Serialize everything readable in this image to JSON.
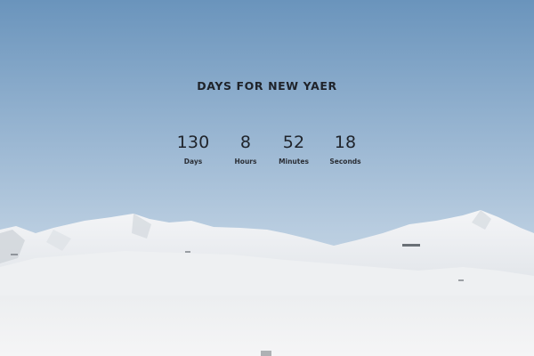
{
  "page": {
    "title": "DAYS FOR NEW YAER"
  },
  "countdown": [
    {
      "value": "130",
      "label": "Days"
    },
    {
      "value": "8",
      "label": "Hours"
    },
    {
      "value": "52",
      "label": "Minutes"
    },
    {
      "value": "18",
      "label": "Seconds"
    }
  ],
  "colors": {
    "sky_top": "#6f98bf",
    "sky_bottom": "#c7d6e4",
    "snow": "#f3f4f5",
    "text": "#1f232a"
  }
}
